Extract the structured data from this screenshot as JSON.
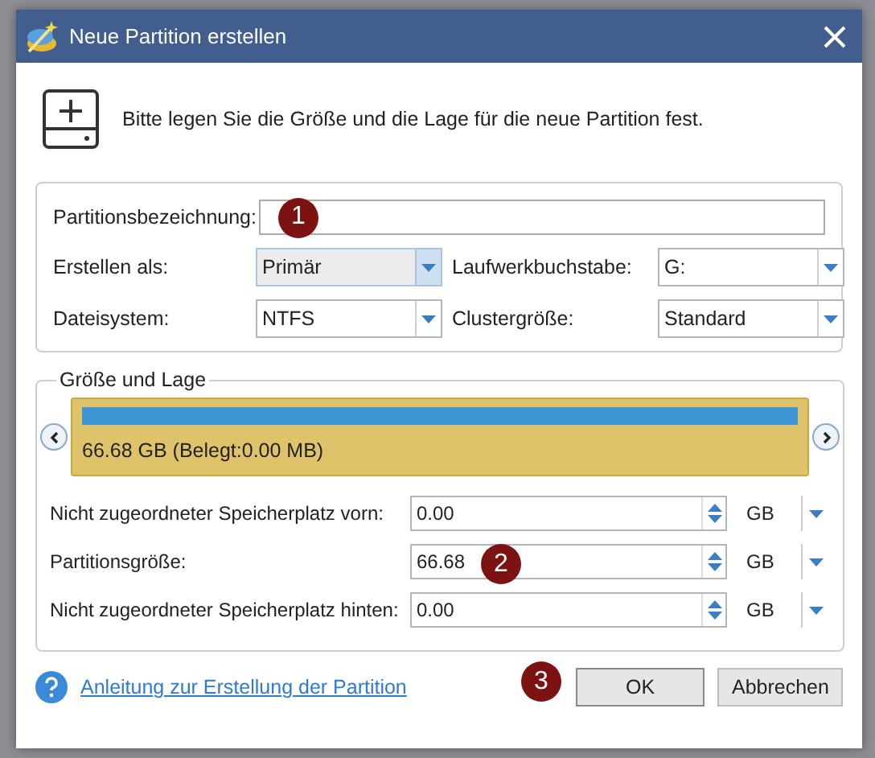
{
  "window": {
    "title": "Neue Partition erstellen"
  },
  "header": {
    "text": "Bitte legen Sie die Größe und die Lage für die neue Partition fest."
  },
  "name_field": {
    "label": "Partitionsbezeichnung:",
    "marker": "1"
  },
  "combos": [
    {
      "label": "Erstellen als:",
      "value": "Primär",
      "focused": true
    },
    {
      "label": "Laufwerkbuchstabe:",
      "value": "G:",
      "focused": false
    },
    {
      "label": "Dateisystem:",
      "value": "NTFS",
      "focused": false
    },
    {
      "label": "Clustergröße:",
      "value": "Standard",
      "focused": false
    }
  ],
  "size_group": {
    "legend": "Größe und Lage",
    "bar_text": "66.68 GB (Belegt:0.00 MB)",
    "rows": [
      {
        "label": "Nicht zugeordneter Speicherplatz vorn:",
        "value": "0.00",
        "unit": "GB"
      },
      {
        "label": "Partitionsgröße:",
        "value": "66.68",
        "unit": "GB",
        "marker": "2"
      },
      {
        "label": "Nicht zugeordneter Speicherplatz hinten:",
        "value": "0.00",
        "unit": "GB"
      }
    ]
  },
  "help_link": "Anleitung zur Erstellung der Partition",
  "buttons": [
    {
      "label": "OK",
      "default": true,
      "marker": "3"
    },
    {
      "label": "Abbrechen",
      "default": false
    }
  ]
}
